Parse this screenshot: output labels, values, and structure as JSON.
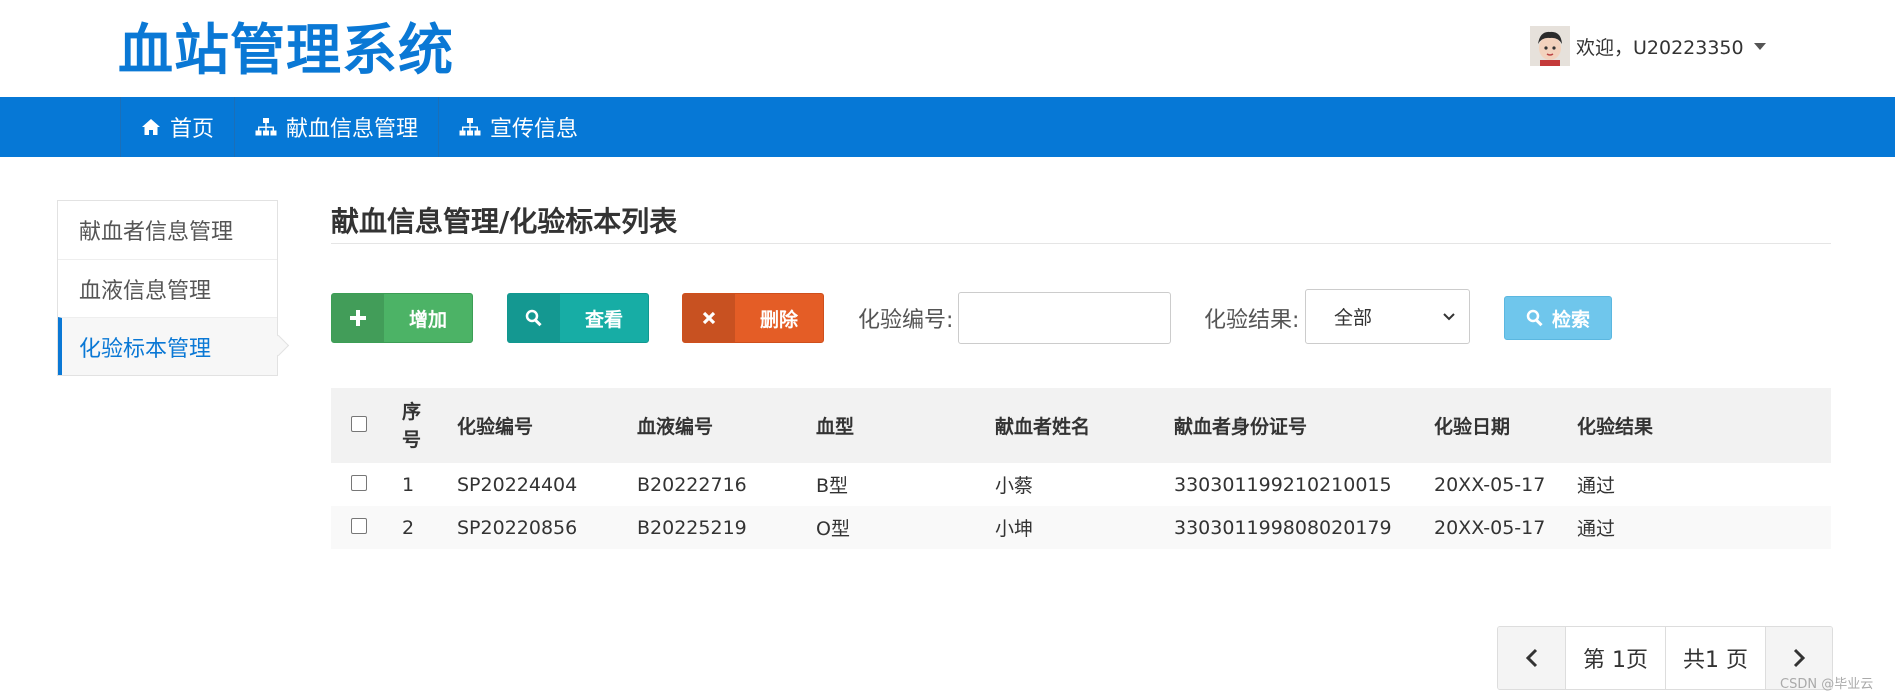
{
  "header": {
    "logo": "血站管理系统",
    "user_name": "欢迎，U20223350"
  },
  "nav": {
    "items": [
      {
        "label": "首页",
        "icon": "home-icon"
      },
      {
        "label": "献血信息管理",
        "icon": "sitemap-icon"
      },
      {
        "label": "宣传信息",
        "icon": "sitemap-icon"
      }
    ]
  },
  "sidebar": {
    "items": [
      {
        "label": "献血者信息管理",
        "active": false
      },
      {
        "label": "血液信息管理",
        "active": false
      },
      {
        "label": "化验标本管理",
        "active": true
      }
    ]
  },
  "main": {
    "title": "献血信息管理/化验标本列表",
    "toolbar": {
      "add_label": "增加",
      "view_label": "查看",
      "delete_label": "删除",
      "no_label": "化验编号:",
      "no_value": "",
      "result_label": "化验结果:",
      "result_value": "全部",
      "search_label": "检索"
    },
    "table": {
      "headers": [
        "序号",
        "化验编号",
        "血液编号",
        "血型",
        "献血者姓名",
        "献血者身份证号",
        "化验日期",
        "化验结果"
      ],
      "rows": [
        [
          "1",
          "SP20224404",
          "B20222716",
          "B型",
          "小蔡",
          "330301199210210015",
          "20XX-05-17",
          "通过"
        ],
        [
          "2",
          "SP20220856",
          "B20225219",
          "O型",
          "小坤",
          "330301199808020179",
          "20XX-05-17",
          "通过"
        ]
      ]
    },
    "pager": {
      "current": "第 1页",
      "total": "共1 页"
    }
  },
  "watermark": "CSDN @毕业云",
  "colors": {
    "brand": "#0678d6",
    "add": "#4cb366",
    "view": "#17ada5",
    "delete": "#e45d26",
    "search": "#6fc6ec"
  }
}
